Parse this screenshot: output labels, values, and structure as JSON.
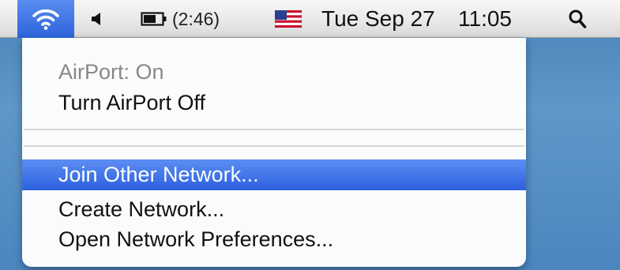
{
  "menubar": {
    "icons": {
      "wifi": "wifi-icon",
      "speaker": "speaker-icon",
      "battery": "battery-icon",
      "flag": "us-flag-icon",
      "search": "spotlight-search-icon"
    },
    "battery_time": "(2:46)",
    "date": "Tue Sep 27",
    "time": "11:05"
  },
  "menu": {
    "status": "AirPort: On",
    "turn_off": "Turn AirPort Off",
    "join_other": "Join Other Network...",
    "create": "Create Network...",
    "preferences": "Open Network Preferences..."
  },
  "colors": {
    "highlight": "#2c60de",
    "desktop": "#5f97c9",
    "disabled_text": "#888888"
  }
}
